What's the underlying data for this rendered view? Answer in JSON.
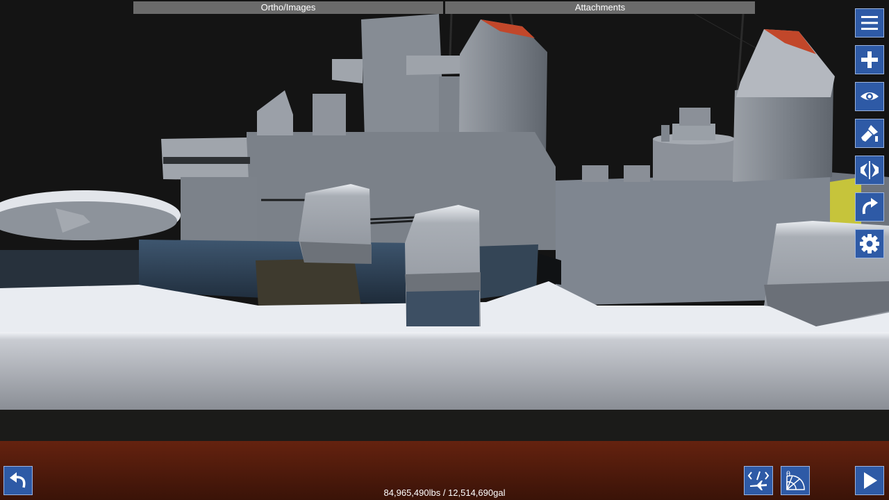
{
  "top_tabs": {
    "ortho_images": "Ortho/Images",
    "attachments": "Attachments"
  },
  "toolbar": {
    "menu": "menu-icon",
    "add_part": "plus-icon",
    "view": "eye-icon",
    "paint": "paint-brush-icon",
    "symmetry": "symmetry-icon",
    "rotate": "rotate-icon",
    "settings": "gear-icon"
  },
  "bottom_bar": {
    "undo": "undo-icon",
    "xml_editor": "xml-aircraft-icon",
    "fine_tuner": "angle-radar-icon",
    "launch": "play-icon",
    "mass_fuel": "84,965,490lbs / 12,514,690gal"
  },
  "colors": {
    "button_bg": "#2e5aa6",
    "button_border": "#9db5e0",
    "tab_bg": "#6b6b6b",
    "hull_gray": "#8a8f96",
    "deck_white": "#e9ecf1",
    "waterline_red": "#5a1f10"
  }
}
